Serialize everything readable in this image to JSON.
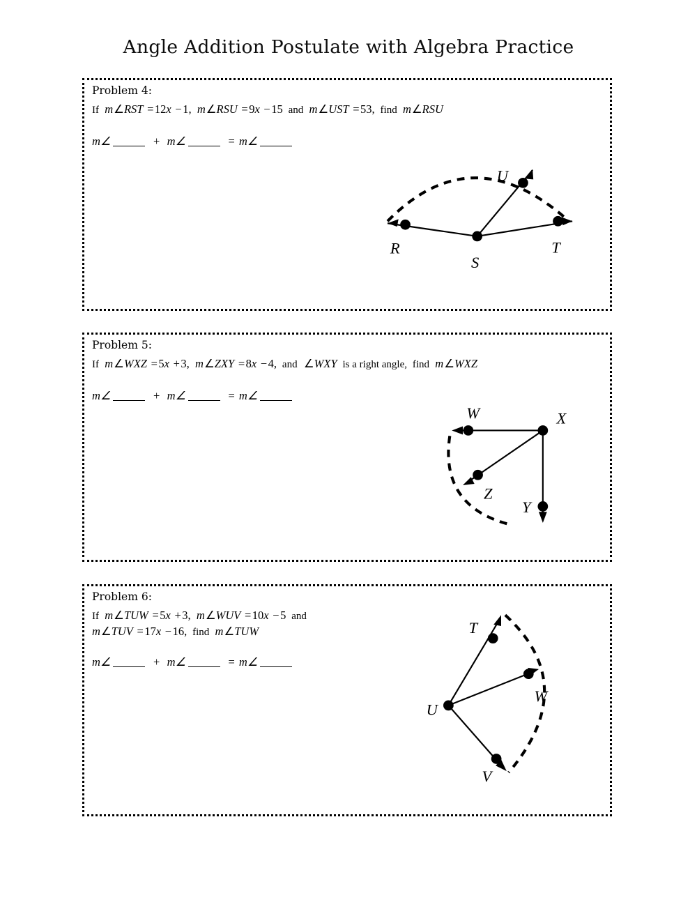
{
  "document": {
    "title": "Angle Addition Postulate with Algebra Practice"
  },
  "problems": [
    {
      "id": "p4",
      "heading": "Problem 4:",
      "statement_lines": [
        "If m∠RST = 12x − 1, m∠RSU = 9x − 15 and m∠UST = 53, find m∠RSU"
      ],
      "equation_template": "m∠ ____ + m∠ ____ = m∠ ____",
      "blanks": [
        "",
        "",
        ""
      ],
      "given": [
        {
          "angle": "m∠RST",
          "expression": "12x − 1"
        },
        {
          "angle": "m∠RSU",
          "expression": "9x − 15"
        },
        {
          "angle": "m∠UST",
          "expression": "53"
        }
      ],
      "find": "m∠RSU",
      "diagram": {
        "vertex": "S",
        "points": [
          "R",
          "S",
          "U",
          "T"
        ],
        "rays": [
          "SR",
          "SU",
          "ST"
        ],
        "arc": "dashed arc from ray SR to ray ST"
      }
    },
    {
      "id": "p5",
      "heading": "Problem 5:",
      "statement_lines": [
        "If m∠WXZ = 5x + 3, m∠ZXY = 8x − 4, and ∠WXY is a right angle, find m∠WXZ"
      ],
      "equation_template": "m∠ ____ + m∠ ____ = m∠ ____",
      "blanks": [
        "",
        "",
        ""
      ],
      "given": [
        {
          "angle": "m∠WXZ",
          "expression": "5x + 3"
        },
        {
          "angle": "m∠ZXY",
          "expression": "8x − 4"
        },
        {
          "angle": "∠WXY",
          "expression": "right angle"
        }
      ],
      "find": "m∠WXZ",
      "diagram": {
        "vertex": "X",
        "points": [
          "W",
          "X",
          "Z",
          "Y"
        ],
        "rays": [
          "XW",
          "XZ",
          "XY"
        ],
        "arc": "dashed arc from ray XW to ray XY"
      }
    },
    {
      "id": "p6",
      "heading": "Problem 6:",
      "statement_lines": [
        "If m∠TUW = 5x + 3, m∠WUV = 10x − 5 and",
        "m∠TUV = 17x − 16, find m∠TUW"
      ],
      "equation_template": "m∠ ____ + m∠ ____ = m∠ ____",
      "blanks": [
        "",
        "",
        ""
      ],
      "given": [
        {
          "angle": "m∠TUW",
          "expression": "5x + 3"
        },
        {
          "angle": "m∠WUV",
          "expression": "10x − 5"
        },
        {
          "angle": "m∠TUV",
          "expression": "17x − 16"
        }
      ],
      "find": "m∠TUW",
      "diagram": {
        "vertex": "U",
        "points": [
          "T",
          "U",
          "W",
          "V"
        ],
        "rays": [
          "UT",
          "UW",
          "UV"
        ],
        "arc": "dashed arc from ray UT to ray UV"
      }
    }
  ],
  "labels": {
    "p4": {
      "R": "R",
      "S": "S",
      "T": "T",
      "U": "U"
    },
    "p5": {
      "W": "W",
      "X": "X",
      "Y": "Y",
      "Z": "Z"
    },
    "p6": {
      "T": "T",
      "U": "U",
      "V": "V",
      "W": "W"
    }
  },
  "math_tokens": {
    "m": "m",
    "angle": "∠",
    "equals": "=",
    "plus": "+",
    "minus": "−",
    "comma": ",",
    "if": "If",
    "and": "and",
    "find": "find",
    "is_a_right_angle": "is a right angle,"
  },
  "style": {
    "ink": "#000000",
    "paper": "#ffffff"
  }
}
